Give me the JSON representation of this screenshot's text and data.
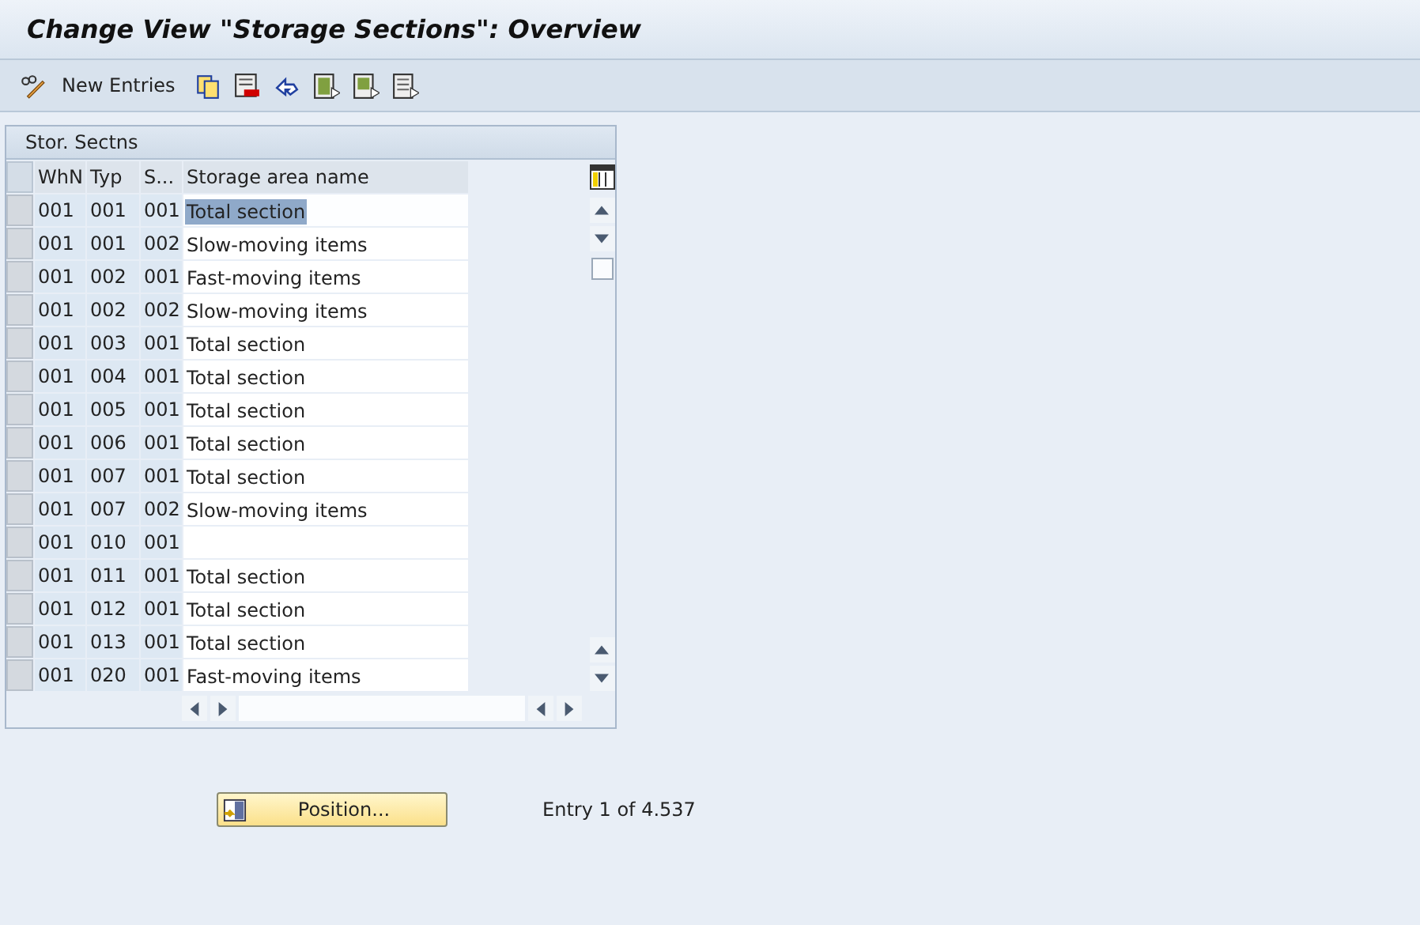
{
  "window": {
    "title": "Change View \"Storage Sections\": Overview"
  },
  "toolbar": {
    "new_entries": "New Entries"
  },
  "table": {
    "title": "Stor. Sectns",
    "columns": [
      "WhN",
      "Typ",
      "S...",
      "Storage area name"
    ],
    "rows": [
      {
        "cells": [
          "001",
          "001",
          "001",
          "Total section"
        ],
        "selected": true
      },
      {
        "cells": [
          "001",
          "001",
          "002",
          "Slow-moving items"
        ],
        "selected": false
      },
      {
        "cells": [
          "001",
          "002",
          "001",
          "Fast-moving items"
        ],
        "selected": false
      },
      {
        "cells": [
          "001",
          "002",
          "002",
          "Slow-moving items"
        ],
        "selected": false
      },
      {
        "cells": [
          "001",
          "003",
          "001",
          "Total section"
        ],
        "selected": false
      },
      {
        "cells": [
          "001",
          "004",
          "001",
          "Total section"
        ],
        "selected": false
      },
      {
        "cells": [
          "001",
          "005",
          "001",
          "Total section"
        ],
        "selected": false
      },
      {
        "cells": [
          "001",
          "006",
          "001",
          "Total section"
        ],
        "selected": false
      },
      {
        "cells": [
          "001",
          "007",
          "001",
          "Total section"
        ],
        "selected": false
      },
      {
        "cells": [
          "001",
          "007",
          "002",
          "Slow-moving items"
        ],
        "selected": false
      },
      {
        "cells": [
          "001",
          "010",
          "001",
          ""
        ],
        "selected": false
      },
      {
        "cells": [
          "001",
          "011",
          "001",
          "Total section"
        ],
        "selected": false
      },
      {
        "cells": [
          "001",
          "012",
          "001",
          "Total section"
        ],
        "selected": false
      },
      {
        "cells": [
          "001",
          "013",
          "001",
          "Total section"
        ],
        "selected": false
      },
      {
        "cells": [
          "001",
          "020",
          "001",
          "Fast-moving items"
        ],
        "selected": false
      }
    ]
  },
  "position_button": "Position...",
  "entry_info": "Entry 1 of 4.537"
}
